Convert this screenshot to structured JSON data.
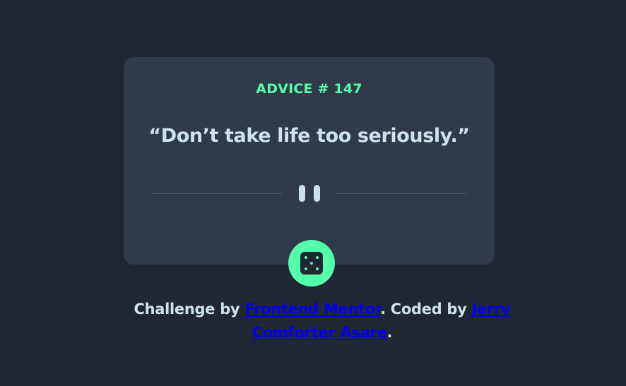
{
  "card": {
    "advice_label": "ADVICE # 147",
    "quote": "“Don’t take life too seriously.”"
  },
  "dice_button": {
    "icon": "dice-icon"
  },
  "attribution": {
    "prefix": "Challenge by ",
    "challenge_link": "Frontend Mentor",
    "middle": ". Coded by ",
    "author_link": "Jerry Comforter Asare",
    "suffix": "."
  },
  "colors": {
    "background": "#202632",
    "card": "#313a48",
    "accent": "#53ffaa",
    "text": "#cee3e9",
    "divider": "#4f5d74",
    "link": "#0000ee"
  }
}
